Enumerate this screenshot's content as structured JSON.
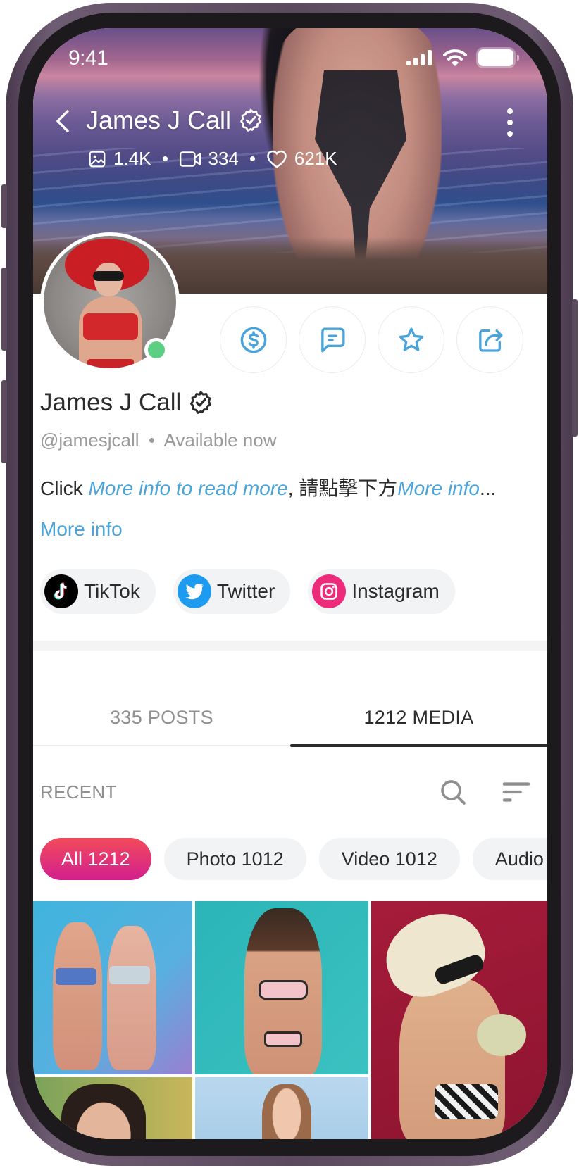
{
  "status_bar": {
    "time": "9:41",
    "icons": [
      "cellular-signal-icon",
      "wifi-icon",
      "battery-icon"
    ]
  },
  "header": {
    "title": "James J Call",
    "verified_icon": "verified-badge-icon",
    "back_icon": "chevron-left-icon",
    "menu_icon": "more-vertical-icon",
    "stats": [
      {
        "icon": "image-icon",
        "value": "1.4K"
      },
      {
        "icon": "video-icon",
        "value": "334"
      },
      {
        "icon": "heart-icon",
        "value": "621K"
      }
    ]
  },
  "profile": {
    "name": "James J Call",
    "handle": "@jamesjcall",
    "availability": "Available now",
    "online": true,
    "online_color": "#5dcf83",
    "bio": {
      "prefix": "Click ",
      "link1": "More info to read more",
      "middle": ", 請點擊下方",
      "link2": "More info",
      "suffix": "..."
    },
    "more_info_label": "More info"
  },
  "actions": [
    {
      "name": "tip",
      "icon": "dollar-circle-icon"
    },
    {
      "name": "message",
      "icon": "message-square-icon"
    },
    {
      "name": "favorite",
      "icon": "star-icon"
    },
    {
      "name": "share",
      "icon": "share-icon"
    }
  ],
  "socials": [
    {
      "label": "TikTok",
      "icon": "tiktok-icon",
      "color": "#000000"
    },
    {
      "label": "Twitter",
      "icon": "twitter-icon",
      "color": "#1d9bf0"
    },
    {
      "label": "Instagram",
      "icon": "instagram-icon",
      "color": "#ee2a7b"
    }
  ],
  "tabs": [
    {
      "label": "335 POSTS",
      "active": false
    },
    {
      "label": "1212 MEDIA",
      "active": true
    }
  ],
  "recent": {
    "label": "RECENT",
    "search_icon": "search-icon",
    "sort_icon": "sort-icon"
  },
  "filters": [
    {
      "label": "All 1212",
      "active": true
    },
    {
      "label": "Photo 1012",
      "active": false
    },
    {
      "label": "Video 1012",
      "active": false
    },
    {
      "label": "Audio",
      "active": false
    }
  ],
  "colors": {
    "accent_blue": "#4aa3d9",
    "active_gradient_start": "#f24b5a",
    "active_gradient_end": "#d31f8f",
    "text_primary": "#2b2b2b",
    "text_secondary": "#9a9a9a"
  },
  "media": [
    {
      "type": "photo",
      "description": "two women in bikinis on blue background"
    },
    {
      "type": "photo",
      "description": "woman in pastel bikini on teal background"
    },
    {
      "type": "photo",
      "description": "woman in straw hat drinking from melon on red background"
    },
    {
      "type": "photo",
      "description": "woman portrait outdoors"
    },
    {
      "type": "photo",
      "description": "woman smiling on light blue background"
    }
  ]
}
